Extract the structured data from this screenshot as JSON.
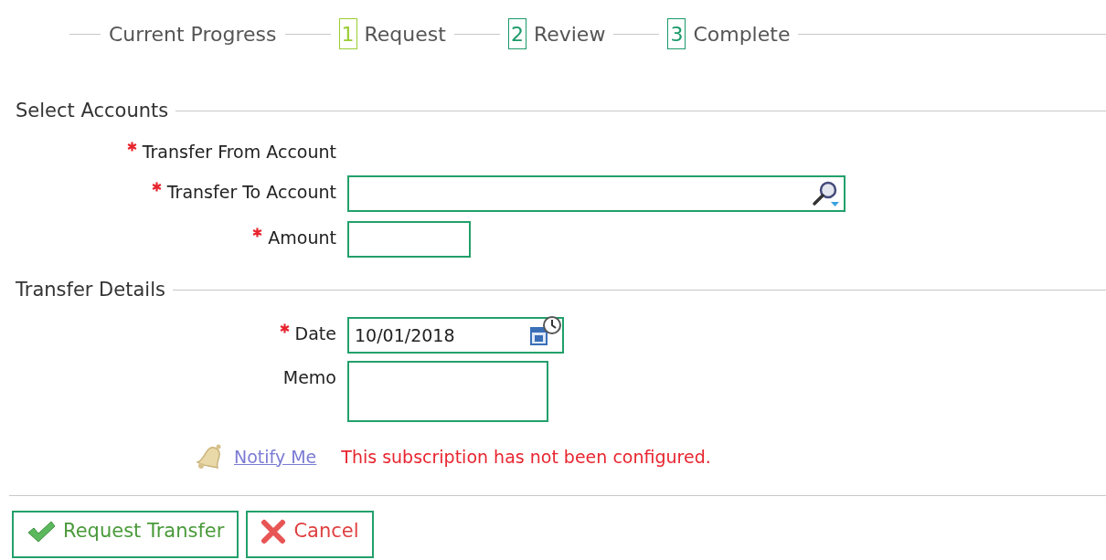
{
  "progress": {
    "label": "Current Progress",
    "steps": [
      {
        "number": "1",
        "label": "Request",
        "selected": true
      },
      {
        "number": "2",
        "label": "Review",
        "selected": false
      },
      {
        "number": "3",
        "label": "Complete",
        "selected": false
      }
    ]
  },
  "sections": [
    {
      "title": "Select Accounts",
      "fields": [
        {
          "kind": "static",
          "label": "Transfer From Account",
          "required": true
        },
        {
          "kind": "lookup",
          "label": "Transfer To Account",
          "required": true
        },
        {
          "kind": "amount",
          "label": "Amount",
          "required": true
        }
      ]
    },
    {
      "title": "Transfer Details",
      "fields": [
        {
          "kind": "date",
          "label": "Date",
          "required": true,
          "value": "10/01/2018"
        },
        {
          "kind": "memo",
          "label": "Memo",
          "required": false
        }
      ]
    }
  ],
  "notify": {
    "link": "Notify Me",
    "message": "This subscription has not been configured."
  },
  "buttons": [
    {
      "kind": "confirm",
      "label": "Request Transfer"
    },
    {
      "kind": "cancel",
      "label": "Cancel"
    }
  ]
}
